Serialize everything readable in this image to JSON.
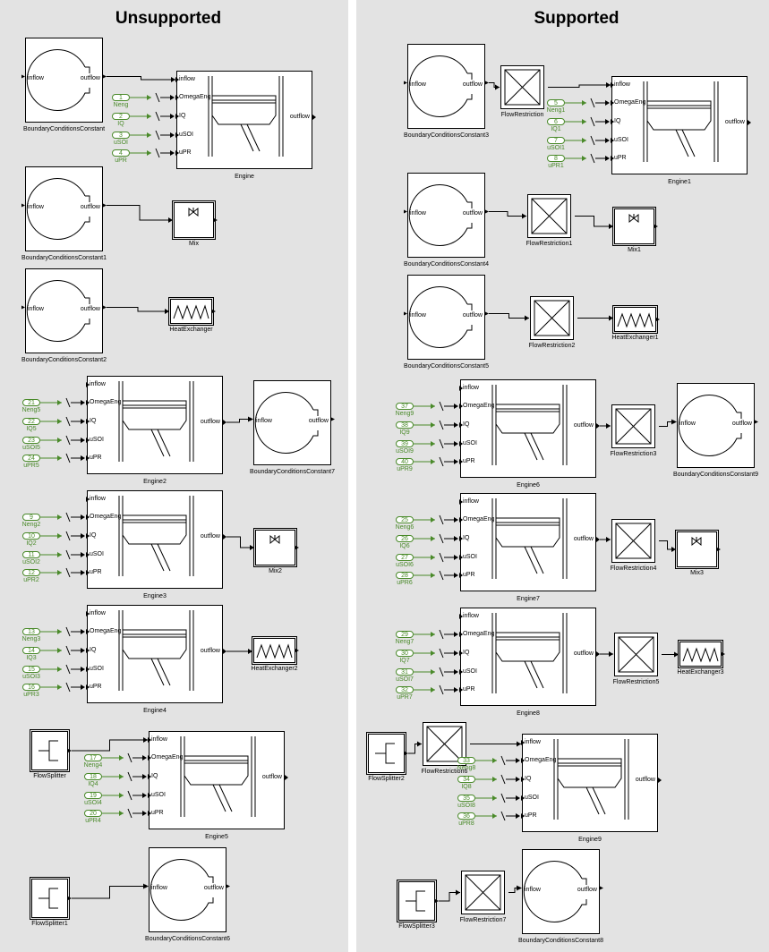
{
  "headings": {
    "left": "Unsupported",
    "right": "Supported"
  },
  "ports": {
    "inflow": "inflow",
    "outflow": "outflow",
    "omega": "OmegaEng",
    "iq": "IQ",
    "usoi": "uSOI",
    "upr": "uPR"
  },
  "blocks": [
    {
      "type": "bc",
      "name": "BoundaryConditionsConstant"
    },
    {
      "type": "engine",
      "name": "Engine",
      "inputs": [
        {
          "n": "1",
          "label": "Neng"
        },
        {
          "n": "2",
          "label": "IQ"
        },
        {
          "n": "3",
          "label": "uSOI"
        },
        {
          "n": "4",
          "label": "uPR"
        }
      ]
    },
    {
      "type": "bc",
      "name": "BoundaryConditionsConstant1"
    },
    {
      "type": "mix",
      "name": "Mix"
    },
    {
      "type": "bc",
      "name": "BoundaryConditionsConstant2"
    },
    {
      "type": "hx",
      "name": "HeatExchanger"
    },
    {
      "type": "engine",
      "name": "Engine2",
      "inputs": [
        {
          "n": "21",
          "label": "Neng5"
        },
        {
          "n": "22",
          "label": "IQ5"
        },
        {
          "n": "23",
          "label": "uSOI5"
        },
        {
          "n": "24",
          "label": "uPR5"
        }
      ]
    },
    {
      "type": "bc",
      "name": "BoundaryConditionsConstant7"
    },
    {
      "type": "engine",
      "name": "Engine3",
      "inputs": [
        {
          "n": "9",
          "label": "Neng2"
        },
        {
          "n": "10",
          "label": "IQ2"
        },
        {
          "n": "11",
          "label": "uSOI2"
        },
        {
          "n": "12",
          "label": "uPR2"
        }
      ]
    },
    {
      "type": "mix",
      "name": "Mix2"
    },
    {
      "type": "engine",
      "name": "Engine4",
      "inputs": [
        {
          "n": "13",
          "label": "Neng3"
        },
        {
          "n": "14",
          "label": "IQ3"
        },
        {
          "n": "15",
          "label": "uSOI3"
        },
        {
          "n": "16",
          "label": "uPR3"
        }
      ]
    },
    {
      "type": "hx",
      "name": "HeatExchanger2"
    },
    {
      "type": "splitter",
      "name": "FlowSplitter"
    },
    {
      "type": "engine",
      "name": "Engine5",
      "inputs": [
        {
          "n": "17",
          "label": "Neng4"
        },
        {
          "n": "18",
          "label": "IQ4"
        },
        {
          "n": "19",
          "label": "uSOI4"
        },
        {
          "n": "20",
          "label": "uPR4"
        }
      ]
    },
    {
      "type": "splitter",
      "name": "FlowSplitter1"
    },
    {
      "type": "bc",
      "name": "BoundaryConditionsConstant6"
    },
    {
      "type": "bc",
      "name": "BoundaryConditionsConstant3"
    },
    {
      "type": "fr",
      "name": "FlowRestriction"
    },
    {
      "type": "engine",
      "name": "Engine1",
      "inputs": [
        {
          "n": "5",
          "label": "Neng1"
        },
        {
          "n": "6",
          "label": "IQ1"
        },
        {
          "n": "7",
          "label": "uSOI1"
        },
        {
          "n": "8",
          "label": "uPR1"
        }
      ]
    },
    {
      "type": "bc",
      "name": "BoundaryConditionsConstant4"
    },
    {
      "type": "fr",
      "name": "FlowRestriction1"
    },
    {
      "type": "mix",
      "name": "Mix1"
    },
    {
      "type": "bc",
      "name": "BoundaryConditionsConstant5"
    },
    {
      "type": "fr",
      "name": "FlowRestriction2"
    },
    {
      "type": "hx",
      "name": "HeatExchanger1"
    },
    {
      "type": "engine",
      "name": "Engine6",
      "inputs": [
        {
          "n": "37",
          "label": "Neng9"
        },
        {
          "n": "38",
          "label": "IQ9"
        },
        {
          "n": "39",
          "label": "uSOI9"
        },
        {
          "n": "40",
          "label": "uPR9"
        }
      ]
    },
    {
      "type": "fr",
      "name": "FlowRestriction3"
    },
    {
      "type": "bc",
      "name": "BoundaryConditionsConstant9"
    },
    {
      "type": "engine",
      "name": "Engine7",
      "inputs": [
        {
          "n": "25",
          "label": "Neng6"
        },
        {
          "n": "26",
          "label": "IQ6"
        },
        {
          "n": "27",
          "label": "uSOI6"
        },
        {
          "n": "28",
          "label": "uPR6"
        }
      ]
    },
    {
      "type": "fr",
      "name": "FlowRestriction4"
    },
    {
      "type": "mix",
      "name": "Mix3"
    },
    {
      "type": "engine",
      "name": "Engine8",
      "inputs": [
        {
          "n": "29",
          "label": "Neng7"
        },
        {
          "n": "30",
          "label": "IQ7"
        },
        {
          "n": "31",
          "label": "uSOI7"
        },
        {
          "n": "32",
          "label": "uPR7"
        }
      ]
    },
    {
      "type": "fr",
      "name": "FlowRestriction5"
    },
    {
      "type": "hx",
      "name": "HeatExchanger3"
    },
    {
      "type": "splitter",
      "name": "FlowSplitter2"
    },
    {
      "type": "fr",
      "name": "FlowRestriction6"
    },
    {
      "type": "engine",
      "name": "Engine9",
      "inputs": [
        {
          "n": "33",
          "label": "Neng8"
        },
        {
          "n": "34",
          "label": "IQ8"
        },
        {
          "n": "35",
          "label": "uSOI8"
        },
        {
          "n": "36",
          "label": "uPR8"
        }
      ]
    },
    {
      "type": "splitter",
      "name": "FlowSplitter3"
    },
    {
      "type": "fr",
      "name": "FlowRestriction7"
    },
    {
      "type": "bc",
      "name": "BoundaryConditionsConstant8"
    }
  ]
}
